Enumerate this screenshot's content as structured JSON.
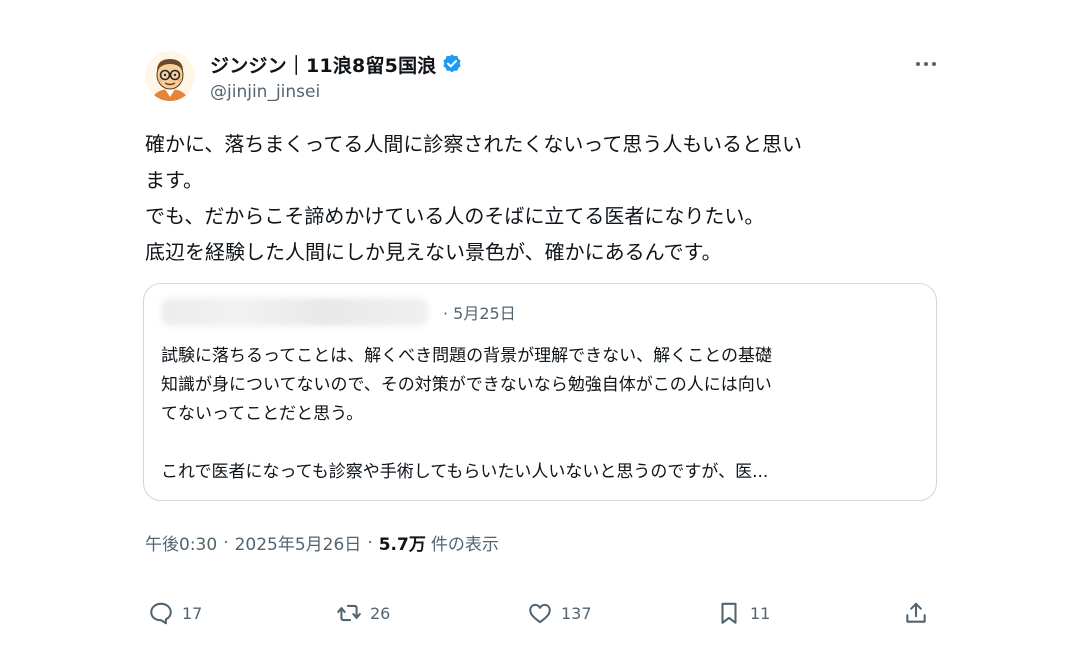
{
  "author": {
    "display_name": "ジンジン｜11浪8留5国浪",
    "handle": "@jinjin_jinsei",
    "verified": true,
    "avatar_icon": "cartoon-man-glasses-avatar"
  },
  "menu_icon": "more-horizontal-icon",
  "tweet": {
    "lines": [
      "確かに、落ちまくってる人間に診察されたくないって思う人もいると思い",
      "ます。",
      "でも、だからこそ諦めかけている人のそばに立てる医者になりたい。",
      "底辺を経験した人間にしか見えない景色が、確かにあるんです。"
    ]
  },
  "quote": {
    "date": "· 5月25日",
    "lines": [
      "試験に落ちるってことは、解くべき問題の背景が理解できない、解くことの基礎",
      "知識が身についてないので、その対策ができないなら勉強自体がこの人には向い",
      "てないってことだと思う。",
      "",
      "これで医者になっても診察や手術してもらいたい人いないと思うのですが、医..."
    ]
  },
  "meta": {
    "time": "午後0:30",
    "separator": "·",
    "date": "2025年5月26日",
    "views_count": "5.7万",
    "views_label": "件の表示"
  },
  "actions": {
    "reply_count": "17",
    "retweet_count": "26",
    "like_count": "137",
    "bookmark_count": "11"
  },
  "colors": {
    "text_primary": "#0f1419",
    "text_secondary": "#536471",
    "verified_blue": "#1d9bf0",
    "border": "#cfd9de"
  }
}
